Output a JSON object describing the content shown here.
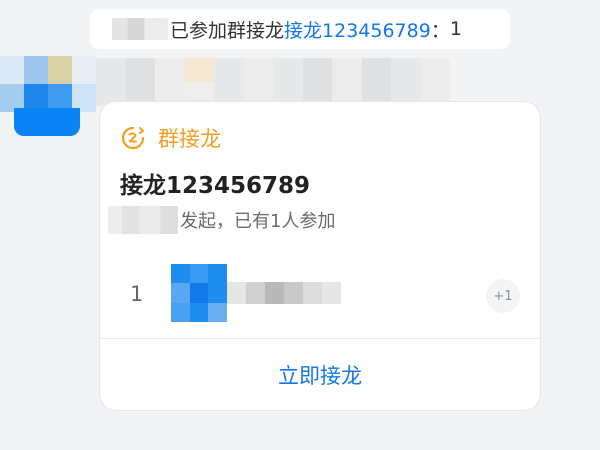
{
  "notice": {
    "text_joined": "已参加群接龙",
    "link_text": "接龙123456789",
    "separator": "：",
    "count": "1"
  },
  "card": {
    "header_label": "群接龙",
    "title": "接龙123456789",
    "subtitle": "发起，已有1人参加",
    "participant_index": "1",
    "plus_badge": "+1",
    "join_button_label": "立即接龙"
  },
  "icons": {
    "header": "solitaire-icon"
  },
  "colors": {
    "accent_orange": "#f0a020",
    "link_blue": "#1478e6",
    "background": "#f2f3f5"
  }
}
